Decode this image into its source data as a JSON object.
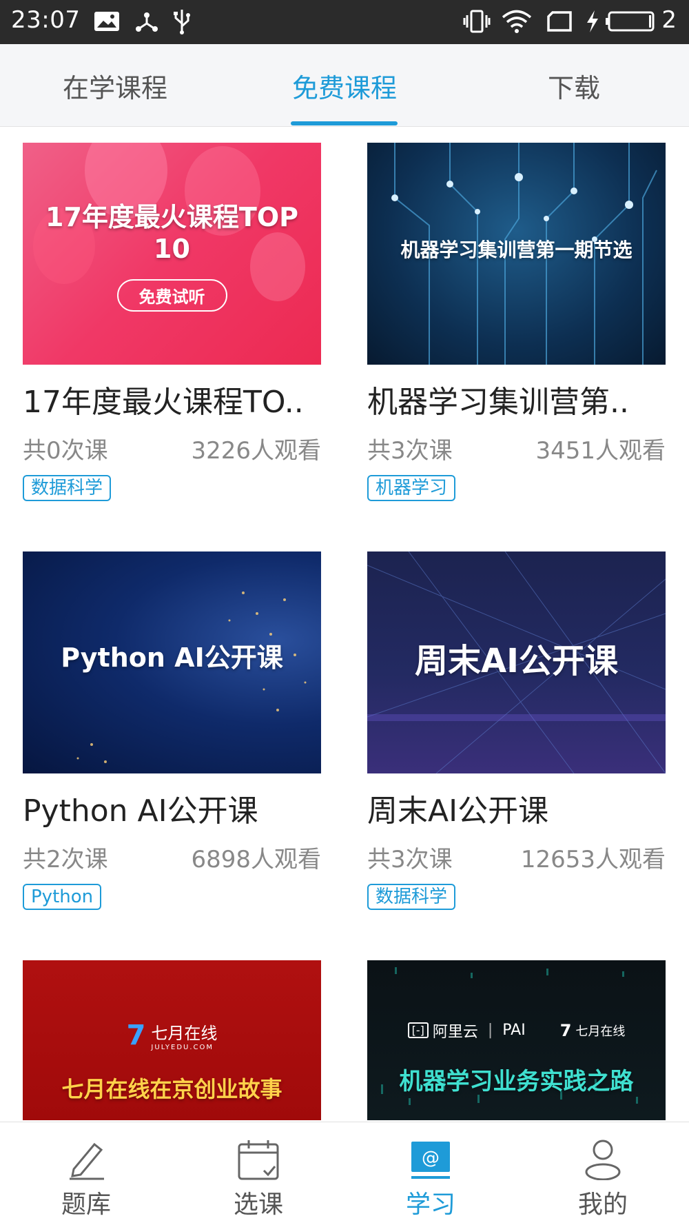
{
  "statusbar": {
    "time": "23:07",
    "battery_level": "2"
  },
  "tabs": [
    {
      "label": "在学课程"
    },
    {
      "label": "免费课程",
      "active": true
    },
    {
      "label": "下载"
    }
  ],
  "courses": [
    {
      "thumb_title": "17年度最火课程TOP 10",
      "thumb_badge": "免费试听",
      "title": "17年度最火课程TO..",
      "lessons": "共0次课",
      "viewers": "3226人观看",
      "tag": "数据科学"
    },
    {
      "thumb_title": "机器学习集训营第一期节选",
      "title": "机器学习集训营第..",
      "lessons": "共3次课",
      "viewers": "3451人观看",
      "tag": "机器学习"
    },
    {
      "thumb_title": "Python AI公开课",
      "title": "Python AI公开课",
      "lessons": "共2次课",
      "viewers": "6898人观看",
      "tag": "Python"
    },
    {
      "thumb_title": "周末AI公开课",
      "title": "周末AI公开课",
      "lessons": "共3次课",
      "viewers": "12653人观看",
      "tag": "数据科学"
    },
    {
      "thumb_brand": "七月在线",
      "thumb_brand_sub": "JULYEDU.COM",
      "thumb_title": "七月在线在京创业故事"
    },
    {
      "thumb_brand_left": "阿里云",
      "thumb_brand_mid": "PAI",
      "thumb_brand_right": "七月在线",
      "thumb_title": "机器学习业务实践之路"
    }
  ],
  "bottomnav": [
    {
      "label": "题库"
    },
    {
      "label": "选课"
    },
    {
      "label": "学习",
      "active": true
    },
    {
      "label": "我的"
    }
  ],
  "colors": {
    "accent": "#1e9bd8",
    "statusbar": "#2b2b2b"
  }
}
